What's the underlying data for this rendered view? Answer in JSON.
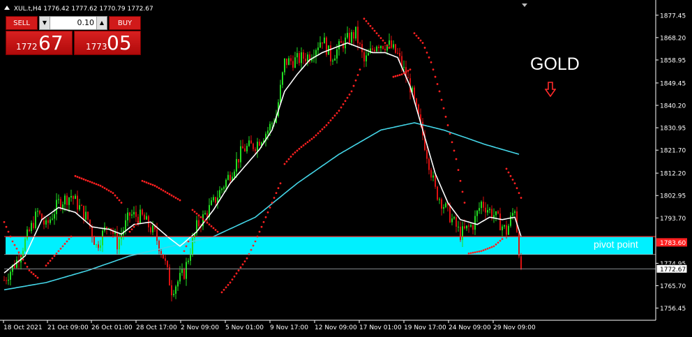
{
  "header": {
    "symbol": "XUL.t,H4",
    "ohlc": "1776.42 1777.62 1770.79 1772.67"
  },
  "trade_panel": {
    "sell_label": "SELL",
    "buy_label": "BUY",
    "lot_value": "0.10",
    "sell_price_small": "1772",
    "sell_price_big": "67",
    "buy_price_small": "1773",
    "buy_price_big": "05"
  },
  "annotations": {
    "gold_label": "GOLD",
    "pivot_label": "pivot point",
    "pivot_price": "1783.60",
    "current_price": "1772.67"
  },
  "colors": {
    "bull": "#22dd22",
    "bear": "#dd1111",
    "psar": "#ff2020",
    "ma_fast": "#ffffff",
    "ma_slow": "#44d6e8",
    "pivot_band": "#00f0ff",
    "pivot_line": "#ff2020",
    "panel_red": "#d11a1a"
  },
  "chart_data": {
    "type": "candlestick",
    "ylim": [
      1752.0,
      1882.0
    ],
    "y_ticks": [
      "1877.45",
      "1868.20",
      "1858.95",
      "1849.45",
      "1840.20",
      "1830.95",
      "1821.70",
      "1812.20",
      "1802.95",
      "1793.70",
      "1783.60",
      "1774.95",
      "1772.67",
      "1765.70",
      "1756.45"
    ],
    "x_ticks": [
      "18 Oct 2021",
      "21 Oct 09:00",
      "26 Oct 01:00",
      "28 Oct 17:00",
      "2 Nov 09:00",
      "5 Nov 01:00",
      "9 Nov 17:00",
      "12 Nov 09:00",
      "17 Nov 01:00",
      "19 Nov 17:00",
      "24 Nov 09:00",
      "29 Nov 09:00"
    ],
    "series": [
      {
        "name": "",
        "type": "candles",
        "anchors": [
          [
            0,
            1768
          ],
          [
            6,
            1776
          ],
          [
            10,
            1784
          ],
          [
            16,
            1796
          ],
          [
            20,
            1790
          ],
          [
            26,
            1800
          ],
          [
            32,
            1803
          ],
          [
            40,
            1793
          ],
          [
            44,
            1782
          ],
          [
            50,
            1792
          ],
          [
            54,
            1783
          ],
          [
            60,
            1795
          ],
          [
            66,
            1794
          ],
          [
            72,
            1787
          ],
          [
            76,
            1778
          ],
          [
            80,
            1764
          ],
          [
            86,
            1771
          ],
          [
            92,
            1790
          ],
          [
            100,
            1800
          ],
          [
            108,
            1812
          ],
          [
            114,
            1822
          ],
          [
            120,
            1824
          ],
          [
            126,
            1830
          ],
          [
            130,
            1836
          ],
          [
            134,
            1858
          ],
          [
            140,
            1859
          ],
          [
            146,
            1861
          ],
          [
            152,
            1868
          ],
          [
            156,
            1860
          ],
          [
            162,
            1866
          ],
          [
            168,
            1870
          ],
          [
            172,
            1858
          ],
          [
            178,
            1866
          ],
          [
            184,
            1865
          ],
          [
            188,
            1861
          ],
          [
            194,
            1848
          ],
          [
            200,
            1828
          ],
          [
            206,
            1805
          ],
          [
            212,
            1796
          ],
          [
            218,
            1787
          ],
          [
            224,
            1791
          ],
          [
            228,
            1800
          ],
          [
            234,
            1795
          ],
          [
            240,
            1788
          ],
          [
            244,
            1798
          ],
          [
            247,
            1772
          ]
        ]
      },
      {
        "name": "",
        "type": "line",
        "anchors": [
          [
            0,
            1771
          ],
          [
            10,
            1778
          ],
          [
            18,
            1793
          ],
          [
            26,
            1798
          ],
          [
            34,
            1796
          ],
          [
            42,
            1790
          ],
          [
            50,
            1789
          ],
          [
            56,
            1787
          ],
          [
            62,
            1791
          ],
          [
            70,
            1792
          ],
          [
            78,
            1786
          ],
          [
            84,
            1782
          ],
          [
            92,
            1788
          ],
          [
            100,
            1797
          ],
          [
            108,
            1808
          ],
          [
            116,
            1816
          ],
          [
            122,
            1822
          ],
          [
            128,
            1830
          ],
          [
            134,
            1846
          ],
          [
            140,
            1853
          ],
          [
            146,
            1859
          ],
          [
            152,
            1862
          ],
          [
            158,
            1864
          ],
          [
            164,
            1866
          ],
          [
            170,
            1864
          ],
          [
            176,
            1862
          ],
          [
            182,
            1862
          ],
          [
            188,
            1860
          ],
          [
            194,
            1848
          ],
          [
            200,
            1830
          ],
          [
            206,
            1812
          ],
          [
            212,
            1800
          ],
          [
            218,
            1793
          ],
          [
            226,
            1791
          ],
          [
            232,
            1794
          ],
          [
            238,
            1793
          ],
          [
            244,
            1794
          ],
          [
            247,
            1786
          ]
        ]
      },
      {
        "name": "",
        "type": "line",
        "anchors": [
          [
            0,
            1764
          ],
          [
            20,
            1767
          ],
          [
            40,
            1772
          ],
          [
            60,
            1778
          ],
          [
            80,
            1782
          ],
          [
            90,
            1784
          ],
          [
            100,
            1786
          ],
          [
            120,
            1794
          ],
          [
            140,
            1808
          ],
          [
            160,
            1820
          ],
          [
            180,
            1830
          ],
          [
            196,
            1833
          ],
          [
            210,
            1830
          ],
          [
            230,
            1824
          ],
          [
            246,
            1820
          ]
        ]
      },
      {
        "name": "",
        "type": "psar",
        "segments": [
          [
            [
              0,
              1792
            ],
            [
              4,
              1784
            ],
            [
              8,
              1778
            ],
            [
              12,
              1772
            ],
            [
              16,
              1769
            ]
          ],
          [
            [
              20,
              1774
            ],
            [
              24,
              1778
            ],
            [
              28,
              1782
            ],
            [
              32,
              1786
            ]
          ],
          [
            [
              34,
              1811
            ],
            [
              40,
              1809
            ],
            [
              46,
              1807
            ],
            [
              52,
              1804
            ],
            [
              56,
              1800
            ]
          ],
          [
            [
              60,
              1788
            ],
            [
              64,
              1792
            ]
          ],
          [
            [
              66,
              1809
            ],
            [
              72,
              1807
            ],
            [
              78,
              1804
            ],
            [
              84,
              1801
            ]
          ],
          [
            [
              86,
              1780
            ],
            [
              88,
              1784
            ]
          ],
          [
            [
              90,
              1797
            ],
            [
              94,
              1794
            ],
            [
              98,
              1791
            ],
            [
              102,
              1788
            ]
          ],
          [
            [
              104,
              1763
            ],
            [
              108,
              1767
            ],
            [
              112,
              1772
            ],
            [
              116,
              1777
            ],
            [
              120,
              1784
            ],
            [
              124,
              1792
            ],
            [
              128,
              1800
            ],
            [
              132,
              1808
            ]
          ],
          [
            [
              134,
              1816
            ],
            [
              138,
              1820
            ],
            [
              142,
              1823
            ],
            [
              148,
              1827
            ],
            [
              154,
              1832
            ],
            [
              160,
              1838
            ],
            [
              166,
              1846
            ],
            [
              170,
              1855
            ]
          ],
          [
            [
              172,
              1876
            ],
            [
              176,
              1872
            ],
            [
              180,
              1868
            ],
            [
              184,
              1864
            ]
          ],
          [
            [
              186,
              1852
            ],
            [
              190,
              1853
            ],
            [
              194,
              1855
            ]
          ],
          [
            [
              196,
              1870
            ],
            [
              200,
              1866
            ],
            [
              204,
              1858
            ],
            [
              208,
              1846
            ],
            [
              212,
              1832
            ],
            [
              216,
              1818
            ],
            [
              220,
              1800
            ]
          ],
          [
            [
              222,
              1779
            ],
            [
              228,
              1780
            ],
            [
              234,
              1782
            ],
            [
              238,
              1785
            ]
          ],
          [
            [
              240,
              1814
            ],
            [
              244,
              1808
            ],
            [
              247,
              1802
            ]
          ]
        ]
      }
    ],
    "pivot": 1783.6,
    "last_price": 1772.67
  }
}
